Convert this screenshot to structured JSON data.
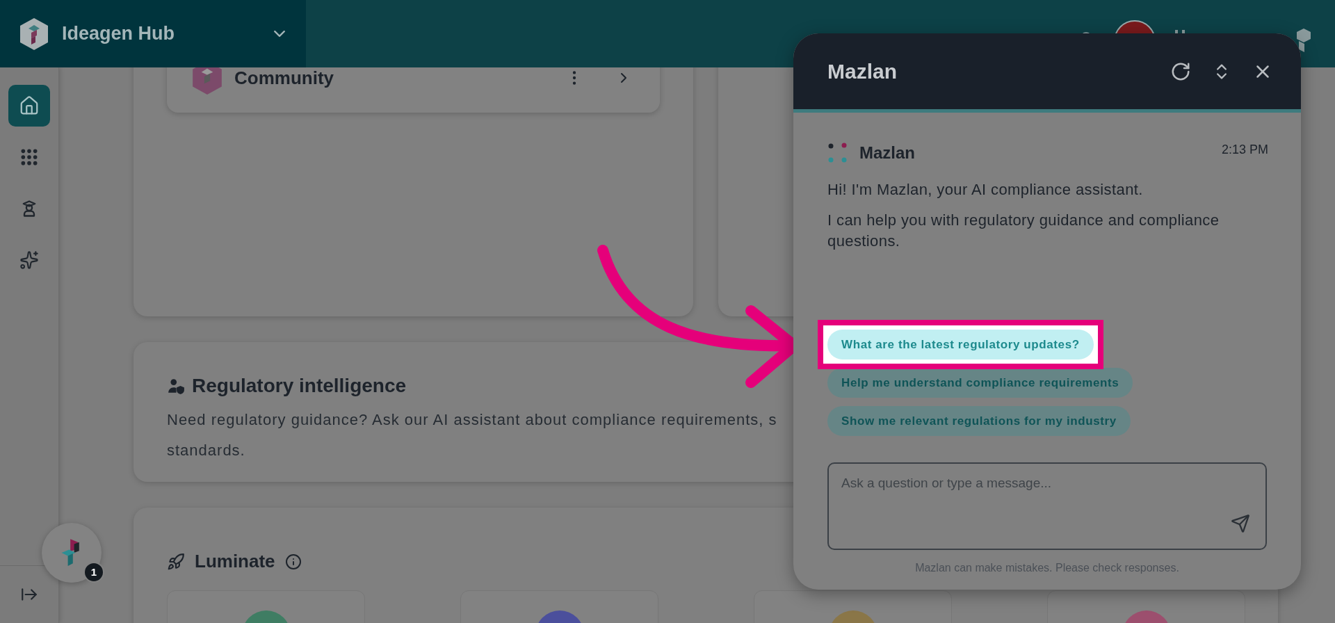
{
  "header": {
    "app_name": "Ideagen Hub"
  },
  "sidebar": {
    "items": [
      {
        "kind": "home",
        "selected": true
      },
      {
        "kind": "apps",
        "selected": false
      },
      {
        "kind": "learning",
        "selected": false
      },
      {
        "kind": "ai",
        "selected": false
      }
    ]
  },
  "launcher": {
    "badge": "1"
  },
  "community_card": {
    "title": "Community"
  },
  "regulatory": {
    "title": "Regulatory intelligence",
    "lines": [
      "Need regulatory guidance? Ask our AI assistant about compliance requirements, s",
      "standards."
    ]
  },
  "luminate": {
    "title": "Luminate",
    "tiles": [
      {
        "color": "#3f7d63"
      },
      {
        "color": "#4b4f9c"
      },
      {
        "color": "#8a7648"
      },
      {
        "color": "#9c4f6e"
      }
    ]
  },
  "chat": {
    "title": "Mazlan",
    "sender": "Mazlan",
    "time": "2:13 PM",
    "messages": [
      "Hi! I'm Mazlan, your AI compliance assistant.",
      "I can help you with regulatory guidance and compliance questions."
    ],
    "suggestions": [
      {
        "label": "What are the latest regulatory updates?",
        "selected": true
      },
      {
        "label": "Help me understand compliance requirements",
        "selected": false
      },
      {
        "label": "Show me relevant regulations for my industry",
        "selected": false
      }
    ],
    "input": {
      "placeholder": "Ask a question or type a message..."
    },
    "disclaimer": "Mazlan can make mistakes. Please check responses."
  }
}
